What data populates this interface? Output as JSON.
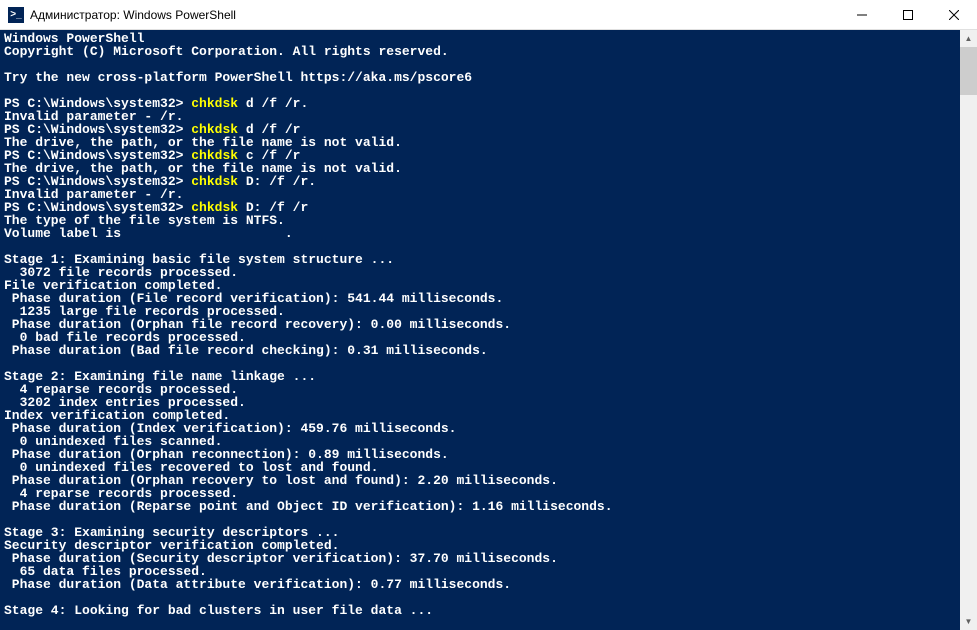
{
  "window": {
    "title": "Администратор: Windows PowerShell",
    "icon_label": ">_"
  },
  "terminal": {
    "header": [
      "Windows PowerShell",
      "Copyright (C) Microsoft Corporation. All rights reserved.",
      "",
      "Try the new cross-platform PowerShell https://aka.ms/pscore6",
      ""
    ],
    "commands": [
      {
        "prompt": "PS C:\\Windows\\system32> ",
        "cmd": "chkdsk",
        "args": " d /f /r.",
        "output": [
          "Invalid parameter - /r."
        ]
      },
      {
        "prompt": "PS C:\\Windows\\system32> ",
        "cmd": "chkdsk",
        "args": " d /f /r",
        "output": [
          "The drive, the path, or the file name is not valid."
        ]
      },
      {
        "prompt": "PS C:\\Windows\\system32> ",
        "cmd": "chkdsk",
        "args": " c /f /r",
        "output": [
          "The drive, the path, or the file name is not valid."
        ]
      },
      {
        "prompt": "PS C:\\Windows\\system32> ",
        "cmd": "chkdsk",
        "args": " D: /f /r.",
        "output": [
          "Invalid parameter - /r."
        ]
      },
      {
        "prompt": "PS C:\\Windows\\system32> ",
        "cmd": "chkdsk",
        "args": " D: /f /r",
        "output": []
      }
    ],
    "body": [
      "The type of the file system is NTFS.",
      "Volume label is                     .",
      "",
      "Stage 1: Examining basic file system structure ...",
      "  3072 file records processed.",
      "File verification completed.",
      " Phase duration (File record verification): 541.44 milliseconds.",
      "  1235 large file records processed.",
      " Phase duration (Orphan file record recovery): 0.00 milliseconds.",
      "  0 bad file records processed.",
      " Phase duration (Bad file record checking): 0.31 milliseconds.",
      "",
      "Stage 2: Examining file name linkage ...",
      "  4 reparse records processed.",
      "  3202 index entries processed.",
      "Index verification completed.",
      " Phase duration (Index verification): 459.76 milliseconds.",
      "  0 unindexed files scanned.",
      " Phase duration (Orphan reconnection): 0.89 milliseconds.",
      "  0 unindexed files recovered to lost and found.",
      " Phase duration (Orphan recovery to lost and found): 2.20 milliseconds.",
      "  4 reparse records processed.",
      " Phase duration (Reparse point and Object ID verification): 1.16 milliseconds.",
      "",
      "Stage 3: Examining security descriptors ...",
      "Security descriptor verification completed.",
      " Phase duration (Security descriptor verification): 37.70 milliseconds.",
      "  65 data files processed.",
      " Phase duration (Data attribute verification): 0.77 milliseconds.",
      "",
      "Stage 4: Looking for bad clusters in user file data ..."
    ]
  }
}
